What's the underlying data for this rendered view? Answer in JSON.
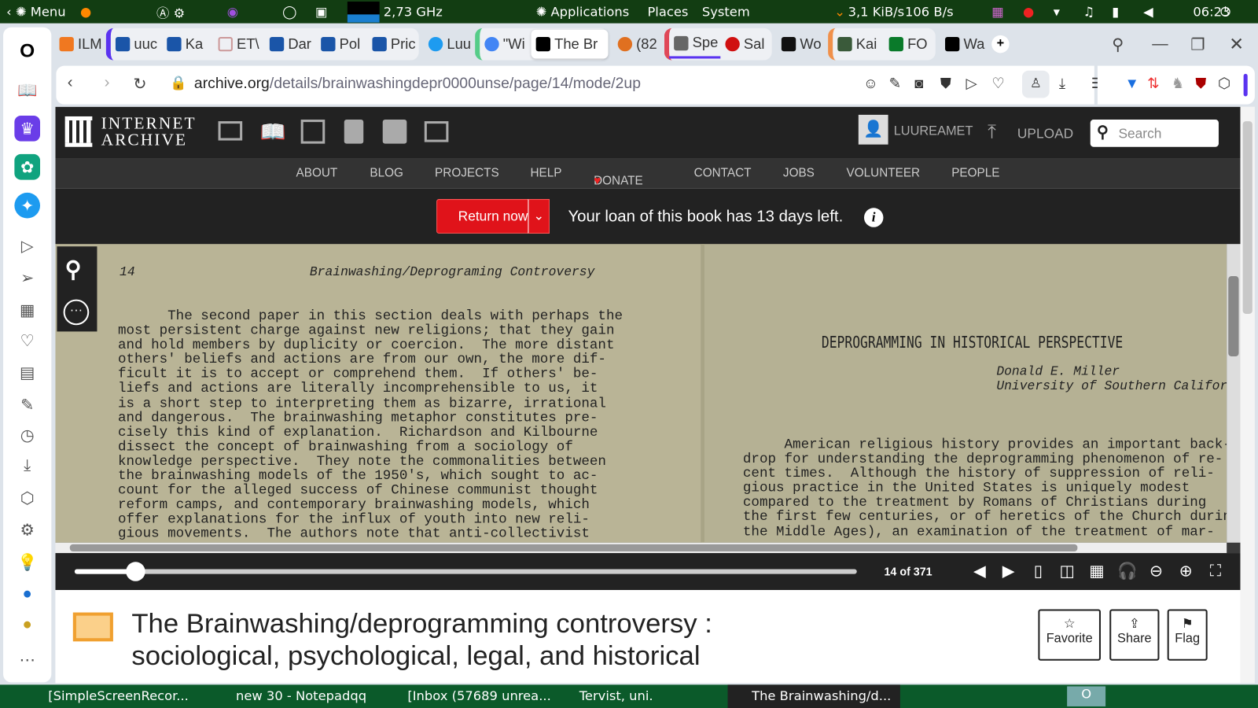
{
  "top_panel": {
    "menu": "Menu",
    "cpu": "2,73 GHz",
    "applications": "Applications",
    "places": "Places",
    "system": "System",
    "net_down": "3,1 KiB/s",
    "net_up": "106 B/s",
    "clock": "06:23"
  },
  "tabs": [
    {
      "label": "ILM",
      "color": "#f07820"
    },
    {
      "label": "uuc",
      "color": "#1a55a8"
    },
    {
      "label": "Ka",
      "color": "#1a55a8"
    },
    {
      "label": "ET\\",
      "color": "#e04040"
    },
    {
      "label": "Dar",
      "color": "#1a55a8"
    },
    {
      "label": "Pol",
      "color": "#1a55a8"
    },
    {
      "label": "Pric",
      "color": "#1a55a8"
    },
    {
      "label": "Luu",
      "color": "#1d9bf0"
    },
    {
      "label": "\"Wi",
      "color": "#4285f4"
    },
    {
      "label": "The Br",
      "color": "#000000"
    },
    {
      "label": "(82",
      "color": "#e07020"
    },
    {
      "label": "Spe",
      "color": "#666666"
    },
    {
      "label": "Sal",
      "color": "#d01010"
    },
    {
      "label": "Wo",
      "color": "#111111"
    },
    {
      "label": "Kai",
      "color": "#3a5a3a"
    },
    {
      "label": "FO",
      "color": "#0a7a2a"
    },
    {
      "label": "Wa",
      "color": "#000000"
    }
  ],
  "address": {
    "domain": "archive.org",
    "path": "/details/brainwashingdepr0000unse/page/14/mode/2up"
  },
  "ia": {
    "logo_line1": "INTERNET",
    "logo_line2": "ARCHIVE",
    "user": "LUUREAMET",
    "upload": "UPLOAD",
    "search_placeholder": "Search",
    "nav": [
      "ABOUT",
      "BLOG",
      "PROJECTS",
      "HELP",
      "DONATE",
      "CONTACT",
      "JOBS",
      "VOLUNTEER",
      "PEOPLE"
    ]
  },
  "loan": {
    "return_button": "Return now",
    "message": "Your loan of this book has 13 days left."
  },
  "book": {
    "left_page": {
      "number": "14",
      "running_head": "Brainwashing/Deprograming Controversy",
      "lines": [
        "      The second paper in this section deals with perhaps the",
        "most persistent charge against new religions; that they gain",
        "and hold members by duplicity or coercion.  The more distant",
        "others' beliefs and actions are from our own, the more dif-",
        "ficult it is to accept or comprehend them.  If others' be-",
        "liefs and actions are literally incomprehensible to us, it",
        "is a short step to interpreting them as bizarre, irrational",
        "and dangerous.  The brainwashing metaphor constitutes pre-",
        "cisely this kind of explanation.  Richardson and Kilbourne",
        "dissect the concept of brainwashing from a sociology of",
        "knowledge perspective.  They note the commonalities between",
        "the brainwashing models of the 1950's, which sought to ac-",
        "count for the alleged success of Chinese communist thought",
        "reform camps, and contemporary brainwashing models, which",
        "offer explanations for the influx of youth into new reli-",
        "gious movements.  The authors note that anti-collectivist"
      ]
    },
    "right_page": {
      "title": "DEPROGRAMMING IN HISTORICAL PERSPECTIVE",
      "author": "Donald E. Miller",
      "affiliation": "University of Southern California",
      "lines": [
        "     American religious history provides an important back-",
        "drop for understanding the deprogramming phenomenon of re-",
        "cent times.  Although the history of suppression of reli-",
        "gious practice in the United States is uniquely modest",
        "compared to the treatment by Romans of Christians during",
        "the first few centuries, or of heretics of the Church during",
        "the Middle Ages), an examination of the treatment of mar-"
      ]
    },
    "page_indicator": "14 of 371",
    "progress": 0.037
  },
  "item": {
    "title_line1": "The Brainwashing/deprogramming controversy :",
    "title_line2": "sociological, psychological, legal, and historical",
    "favorite": "Favorite",
    "share": "Share",
    "flag": "Flag"
  },
  "taskbar": [
    "[SimpleScreenRecor...",
    "new 30 - Notepadqq",
    "[Inbox (57689 unrea...",
    "Tervist, uni.",
    "The Brainwashing/d..."
  ]
}
